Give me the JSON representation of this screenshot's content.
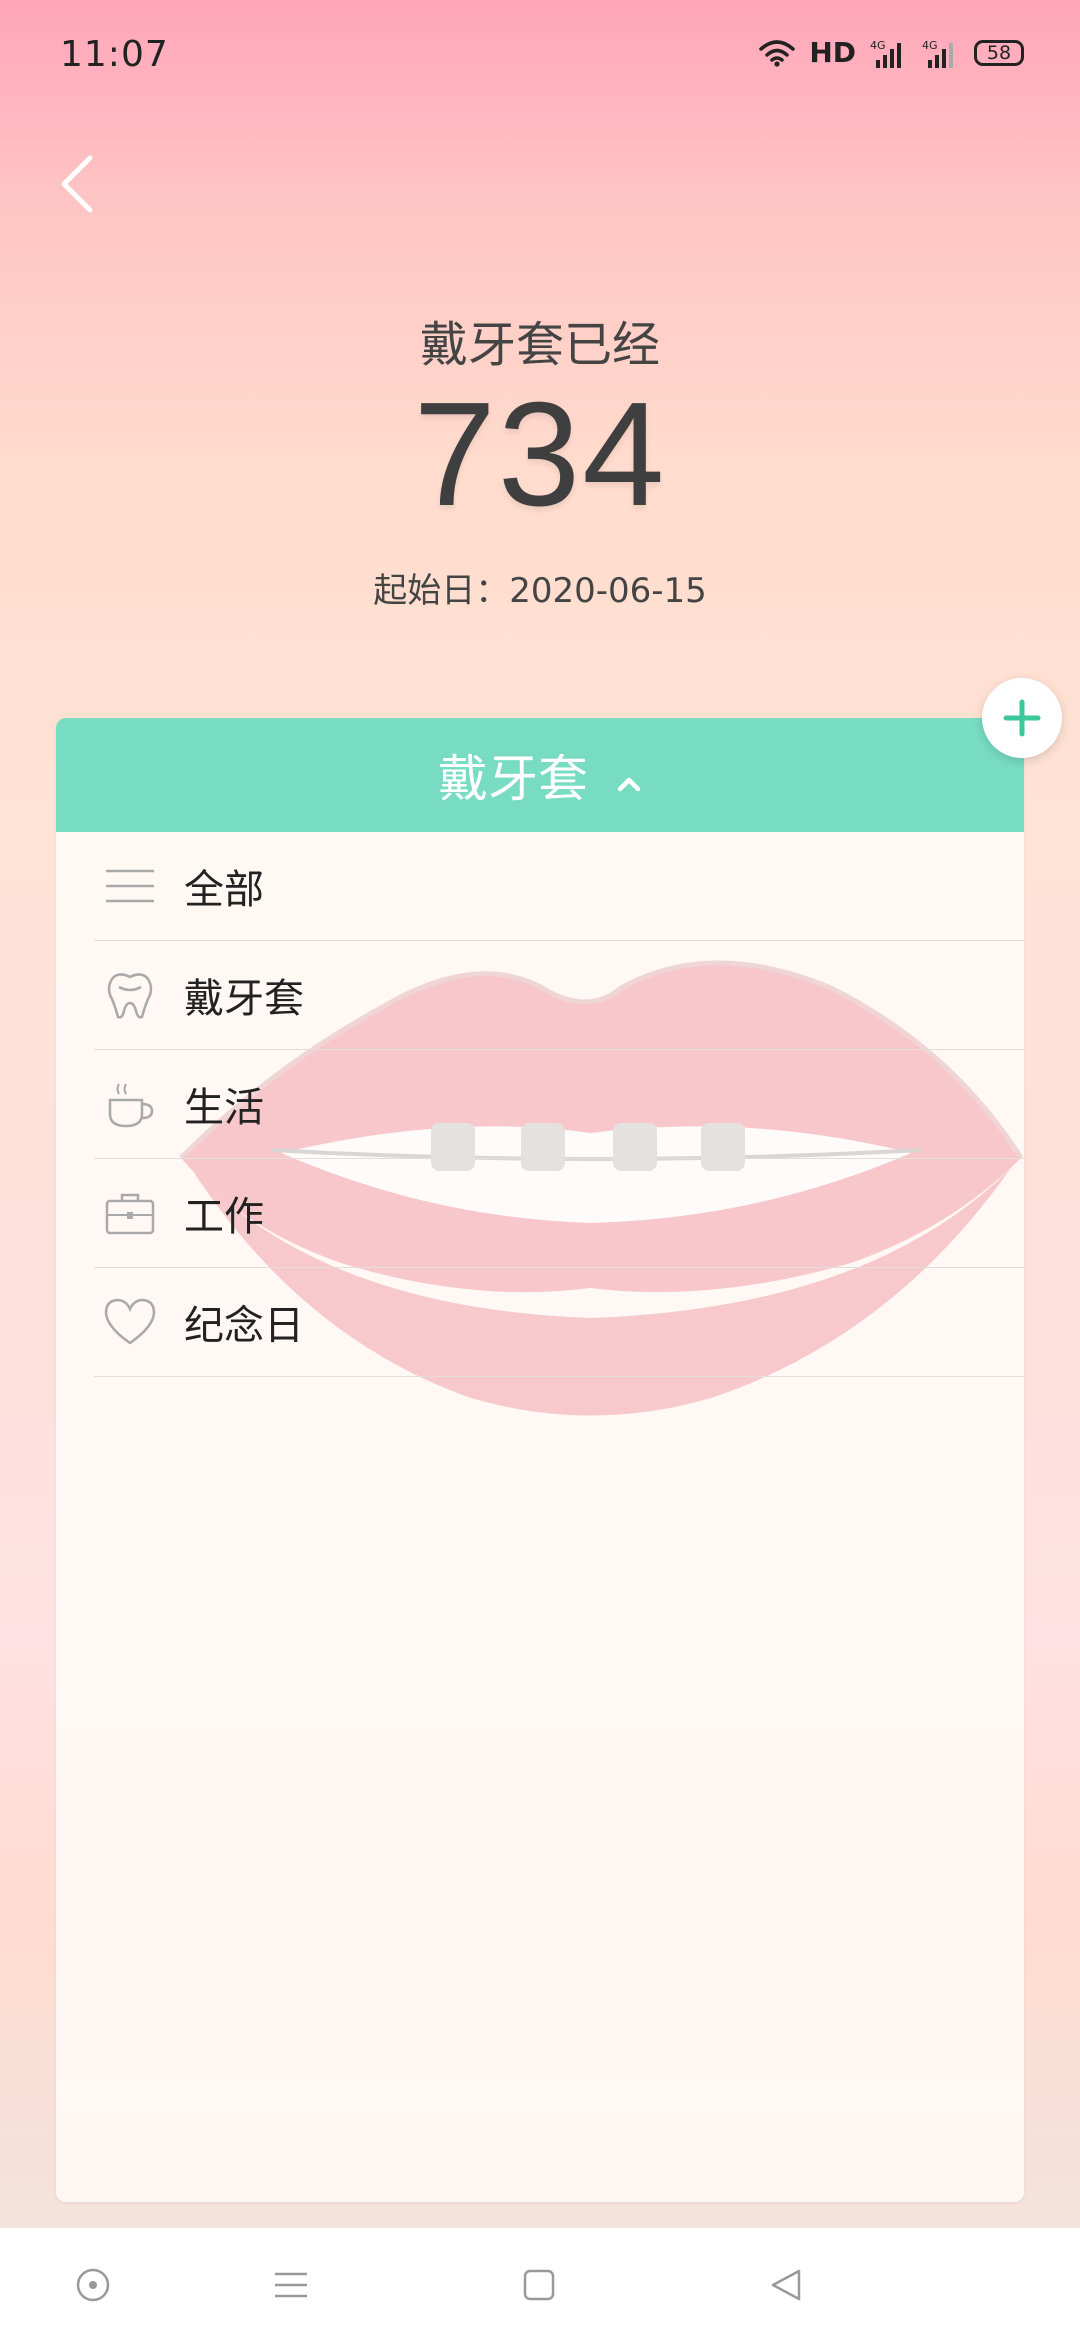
{
  "status_bar": {
    "time": "11:07",
    "network_label": "HD",
    "signal_1": "4G",
    "signal_2": "4G",
    "battery": "58"
  },
  "header": {
    "title": "戴牙套已经",
    "count": "734",
    "start_date": "起始日：2020-06-15"
  },
  "category_panel": {
    "selected": "戴牙套",
    "items": [
      {
        "label": "全部",
        "icon": "list-icon"
      },
      {
        "label": "戴牙套",
        "icon": "tooth-icon"
      },
      {
        "label": "生活",
        "icon": "coffee-cup-icon"
      },
      {
        "label": "工作",
        "icon": "briefcase-icon"
      },
      {
        "label": "纪念日",
        "icon": "heart-icon"
      }
    ]
  },
  "colors": {
    "accent": "#78dcc3",
    "fab_plus": "#3cc89b",
    "icon_gray": "#a9a9a9"
  }
}
